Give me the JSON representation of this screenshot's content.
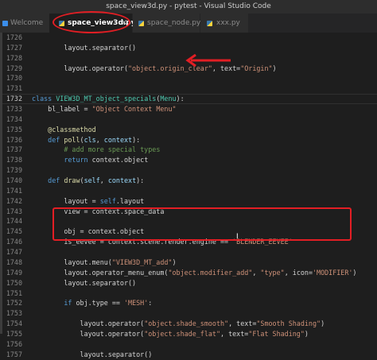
{
  "window_title": "space_view3d.py - pytest - Visual Studio Code",
  "tabs": [
    {
      "label": "Welcome",
      "icon": "vscode-icon"
    },
    {
      "label": "space_view3d.py",
      "icon": "python-file-icon",
      "close": "×"
    },
    {
      "label": "space_node.py",
      "icon": "python-file-icon"
    },
    {
      "label": "xxx.py",
      "icon": "python-file-icon"
    }
  ],
  "current_line": "1732",
  "colors": {
    "annotation": "#e31e24",
    "keyword": "#569cd6",
    "string": "#ce9178",
    "comment": "#6a9955"
  },
  "lines": [
    {
      "n": "1726",
      "code": [
        {
          "t": ""
        }
      ]
    },
    {
      "n": "1727",
      "code": [
        {
          "t": "        layout.separator()"
        }
      ]
    },
    {
      "n": "1728",
      "code": [
        {
          "t": ""
        }
      ]
    },
    {
      "n": "1729",
      "code": [
        {
          "t": "        layout.operator("
        },
        {
          "t": "\"object.origin_clear\"",
          "c": "str"
        },
        {
          "t": ", text="
        },
        {
          "t": "\"Origin\"",
          "c": "str"
        },
        {
          "t": ")"
        }
      ]
    },
    {
      "n": "1730",
      "code": [
        {
          "t": ""
        }
      ]
    },
    {
      "n": "1731",
      "code": [
        {
          "t": ""
        }
      ]
    },
    {
      "n": "1732",
      "code": [
        {
          "t": "class ",
          "c": "kw"
        },
        {
          "t": "VIEW3D_MT_object_specials",
          "c": "cls"
        },
        {
          "t": "("
        },
        {
          "t": "Menu",
          "c": "cls"
        },
        {
          "t": "):"
        }
      ]
    },
    {
      "n": "1733",
      "code": [
        {
          "t": "    bl_label = "
        },
        {
          "t": "\"Object Context Menu\"",
          "c": "str"
        }
      ]
    },
    {
      "n": "1734",
      "code": [
        {
          "t": ""
        }
      ]
    },
    {
      "n": "1735",
      "code": [
        {
          "t": "    "
        },
        {
          "t": "@classmethod",
          "c": "dec"
        }
      ]
    },
    {
      "n": "1736",
      "code": [
        {
          "t": "    "
        },
        {
          "t": "def ",
          "c": "kw"
        },
        {
          "t": "poll",
          "c": "fn"
        },
        {
          "t": "("
        },
        {
          "t": "cls",
          "c": "par"
        },
        {
          "t": ", "
        },
        {
          "t": "context",
          "c": "par"
        },
        {
          "t": "):"
        }
      ]
    },
    {
      "n": "1737",
      "code": [
        {
          "t": "        "
        },
        {
          "t": "# add more special types",
          "c": "cm"
        }
      ]
    },
    {
      "n": "1738",
      "code": [
        {
          "t": "        "
        },
        {
          "t": "return ",
          "c": "kw"
        },
        {
          "t": "context.object"
        }
      ]
    },
    {
      "n": "1739",
      "code": [
        {
          "t": ""
        }
      ]
    },
    {
      "n": "1740",
      "code": [
        {
          "t": "    "
        },
        {
          "t": "def ",
          "c": "kw"
        },
        {
          "t": "draw",
          "c": "fn"
        },
        {
          "t": "("
        },
        {
          "t": "self",
          "c": "par"
        },
        {
          "t": ", "
        },
        {
          "t": "context",
          "c": "par"
        },
        {
          "t": "):"
        }
      ]
    },
    {
      "n": "1741",
      "code": [
        {
          "t": ""
        }
      ]
    },
    {
      "n": "1742",
      "code": [
        {
          "t": "        layout = "
        },
        {
          "t": "self",
          "c": "kw"
        },
        {
          "t": ".layout"
        }
      ]
    },
    {
      "n": "1743",
      "code": [
        {
          "t": "        view = context.space_data"
        }
      ]
    },
    {
      "n": "1744",
      "code": [
        {
          "t": ""
        }
      ]
    },
    {
      "n": "1745",
      "code": [
        {
          "t": "        obj = context.object"
        }
      ]
    },
    {
      "n": "1746",
      "code": [
        {
          "t": "        is_eevee = context.scene.render.engine == "
        },
        {
          "t": "'BLENDER_EEVEE'",
          "c": "str"
        }
      ]
    },
    {
      "n": "1747",
      "code": [
        {
          "t": ""
        }
      ]
    },
    {
      "n": "1748",
      "code": [
        {
          "t": "        layout.menu("
        },
        {
          "t": "\"VIEW3D_MT_add\"",
          "c": "str"
        },
        {
          "t": ")"
        }
      ]
    },
    {
      "n": "1749",
      "code": [
        {
          "t": "        layout.operator_menu_enum("
        },
        {
          "t": "\"object.modifier_add\"",
          "c": "str"
        },
        {
          "t": ", "
        },
        {
          "t": "\"type\"",
          "c": "str"
        },
        {
          "t": ", icon="
        },
        {
          "t": "'MODIFIER'",
          "c": "str"
        },
        {
          "t": ")"
        }
      ]
    },
    {
      "n": "1750",
      "code": [
        {
          "t": "        layout.separator()"
        }
      ]
    },
    {
      "n": "1751",
      "code": [
        {
          "t": ""
        }
      ]
    },
    {
      "n": "1752",
      "code": [
        {
          "t": "        "
        },
        {
          "t": "if ",
          "c": "kw"
        },
        {
          "t": "obj.type == "
        },
        {
          "t": "'MESH'",
          "c": "str"
        },
        {
          "t": ":"
        }
      ]
    },
    {
      "n": "1753",
      "code": [
        {
          "t": ""
        }
      ]
    },
    {
      "n": "1754",
      "code": [
        {
          "t": "            layout.operator("
        },
        {
          "t": "\"object.shade_smooth\"",
          "c": "str"
        },
        {
          "t": ", text="
        },
        {
          "t": "\"Smooth Shading\"",
          "c": "str"
        },
        {
          "t": ")"
        }
      ]
    },
    {
      "n": "1755",
      "code": [
        {
          "t": "            layout.operator("
        },
        {
          "t": "\"object.shade_flat\"",
          "c": "str"
        },
        {
          "t": ", text="
        },
        {
          "t": "\"Flat Shading\"",
          "c": "str"
        },
        {
          "t": ")"
        }
      ]
    },
    {
      "n": "1756",
      "code": [
        {
          "t": ""
        }
      ]
    },
    {
      "n": "1757",
      "code": [
        {
          "t": "            layout.separator()"
        }
      ]
    }
  ]
}
